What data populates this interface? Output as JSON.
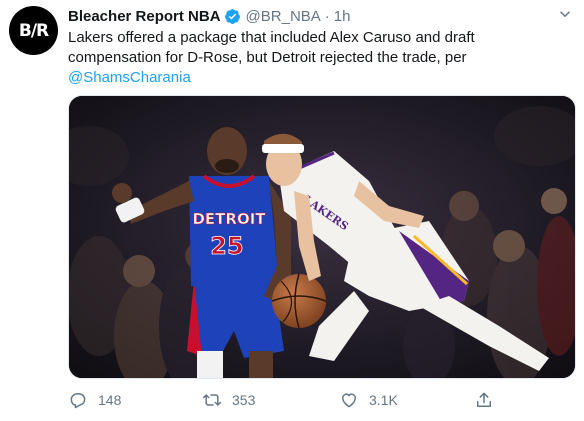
{
  "account": {
    "avatar_text": "B/R",
    "display_name": "Bleacher Report NBA",
    "handle": "@BR_NBA",
    "separator": "·",
    "time": "1h",
    "verified": true
  },
  "tweet": {
    "text": "Lakers offered a package that included Alex Caruso and draft compensation for D-Rose, but Detroit rejected the trade, per ",
    "mention": "@ShamsCharania"
  },
  "media": {
    "jersey_left_team": "DETROIT",
    "jersey_left_number": "25",
    "jersey_right_team": "LAKERS"
  },
  "actions": {
    "reply_count": "148",
    "retweet_count": "353",
    "like_count": "3.1K"
  },
  "colors": {
    "accent": "#1da1f2",
    "muted": "#657786",
    "pistons_blue": "#1d42ba",
    "pistons_red": "#c8102e",
    "lakers_purple": "#552583",
    "lakers_gold": "#fdb927"
  },
  "icons": {
    "verified": "verified-badge-icon",
    "caret": "chevron-down-icon",
    "reply": "reply-bubble-icon",
    "retweet": "retweet-arrows-icon",
    "like": "heart-icon",
    "share": "share-upload-icon"
  }
}
